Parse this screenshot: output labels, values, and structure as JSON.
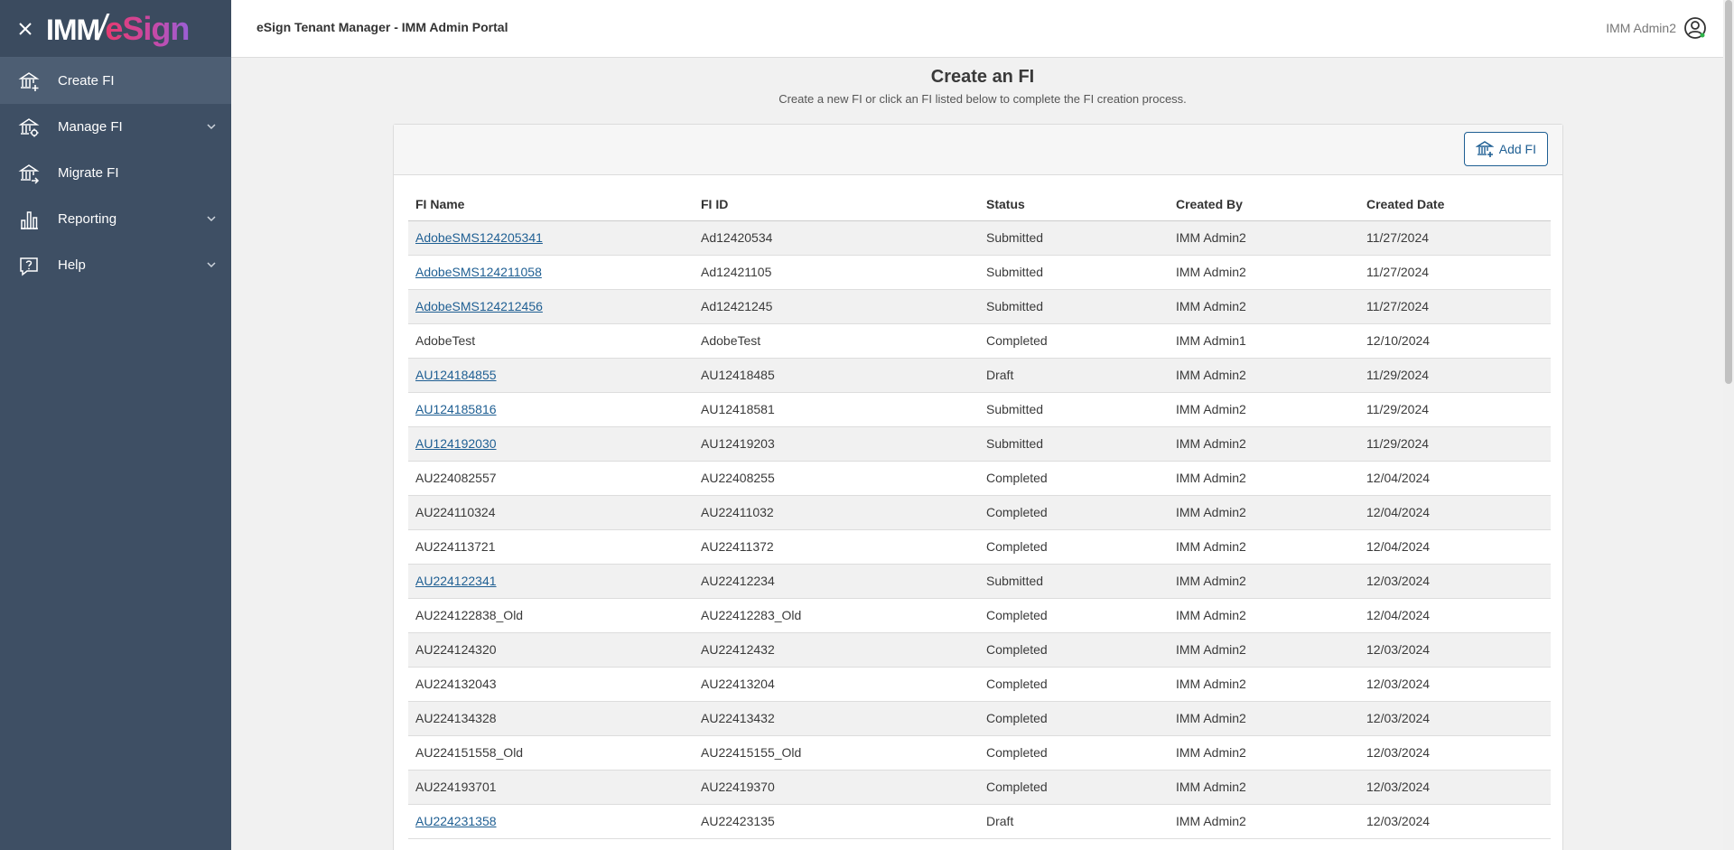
{
  "sidebar": {
    "logo_imm": "IMM",
    "logo_slash": "/",
    "logo_esign": "eSign",
    "items": [
      {
        "label": "Create FI",
        "icon": "bank-add-icon",
        "expandable": false,
        "active": true
      },
      {
        "label": "Manage FI",
        "icon": "bank-gear-icon",
        "expandable": true,
        "active": false
      },
      {
        "label": "Migrate FI",
        "icon": "bank-arrow-icon",
        "expandable": false,
        "active": false
      },
      {
        "label": "Reporting",
        "icon": "bar-chart-icon",
        "expandable": true,
        "active": false
      },
      {
        "label": "Help",
        "icon": "help-bubble-icon",
        "expandable": true,
        "active": false
      }
    ]
  },
  "header": {
    "title": "eSign Tenant Manager - IMM Admin Portal",
    "user_name": "IMM Admin2"
  },
  "main": {
    "title": "Create an FI",
    "subtitle": "Create a new FI or click an FI listed below to complete the FI creation process.",
    "add_button_label": "Add FI",
    "columns": [
      "FI Name",
      "FI ID",
      "Status",
      "Created By",
      "Created Date"
    ],
    "rows": [
      {
        "name": "AdobeSMS124205341",
        "id": "Ad12420534",
        "status": "Submitted",
        "by": "IMM Admin2",
        "date": "11/27/2024",
        "link": true
      },
      {
        "name": "AdobeSMS124211058",
        "id": "Ad12421105",
        "status": "Submitted",
        "by": "IMM Admin2",
        "date": "11/27/2024",
        "link": true
      },
      {
        "name": "AdobeSMS124212456",
        "id": "Ad12421245",
        "status": "Submitted",
        "by": "IMM Admin2",
        "date": "11/27/2024",
        "link": true
      },
      {
        "name": "AdobeTest",
        "id": "AdobeTest",
        "status": "Completed",
        "by": "IMM Admin1",
        "date": "12/10/2024",
        "link": false
      },
      {
        "name": "AU124184855",
        "id": "AU12418485",
        "status": "Draft",
        "by": "IMM Admin2",
        "date": "11/29/2024",
        "link": true
      },
      {
        "name": "AU124185816",
        "id": "AU12418581",
        "status": "Submitted",
        "by": "IMM Admin2",
        "date": "11/29/2024",
        "link": true
      },
      {
        "name": "AU124192030",
        "id": "AU12419203",
        "status": "Submitted",
        "by": "IMM Admin2",
        "date": "11/29/2024",
        "link": true
      },
      {
        "name": "AU224082557",
        "id": "AU22408255",
        "status": "Completed",
        "by": "IMM Admin2",
        "date": "12/04/2024",
        "link": false
      },
      {
        "name": "AU224110324",
        "id": "AU22411032",
        "status": "Completed",
        "by": "IMM Admin2",
        "date": "12/04/2024",
        "link": false
      },
      {
        "name": "AU224113721",
        "id": "AU22411372",
        "status": "Completed",
        "by": "IMM Admin2",
        "date": "12/04/2024",
        "link": false
      },
      {
        "name": "AU224122341",
        "id": "AU22412234",
        "status": "Submitted",
        "by": "IMM Admin2",
        "date": "12/03/2024",
        "link": true
      },
      {
        "name": "AU224122838_Old",
        "id": "AU22412283_Old",
        "status": "Completed",
        "by": "IMM Admin2",
        "date": "12/04/2024",
        "link": false
      },
      {
        "name": "AU224124320",
        "id": "AU22412432",
        "status": "Completed",
        "by": "IMM Admin2",
        "date": "12/03/2024",
        "link": false
      },
      {
        "name": "AU224132043",
        "id": "AU22413204",
        "status": "Completed",
        "by": "IMM Admin2",
        "date": "12/03/2024",
        "link": false
      },
      {
        "name": "AU224134328",
        "id": "AU22413432",
        "status": "Completed",
        "by": "IMM Admin2",
        "date": "12/03/2024",
        "link": false
      },
      {
        "name": "AU224151558_Old",
        "id": "AU22415155_Old",
        "status": "Completed",
        "by": "IMM Admin2",
        "date": "12/03/2024",
        "link": false
      },
      {
        "name": "AU224193701",
        "id": "AU22419370",
        "status": "Completed",
        "by": "IMM Admin2",
        "date": "12/03/2024",
        "link": false
      },
      {
        "name": "AU224231358",
        "id": "AU22423135",
        "status": "Draft",
        "by": "IMM Admin2",
        "date": "12/03/2024",
        "link": true
      }
    ]
  },
  "colors": {
    "sidebar_bg": "#3e4f64",
    "active_item_bg": "#4d5e73",
    "link": "#1f5f93",
    "row_stripe": "#f1f1f1"
  }
}
